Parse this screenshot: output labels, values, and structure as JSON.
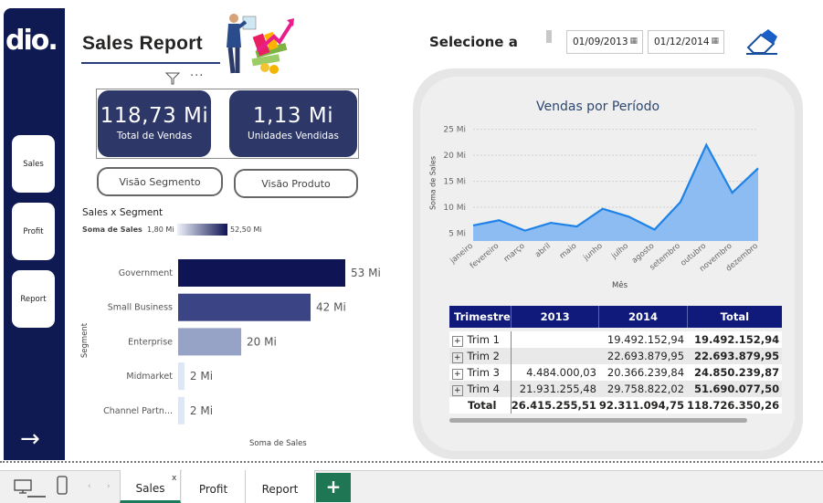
{
  "sidebar": {
    "logo": "dio.",
    "items": [
      {
        "label": "Sales"
      },
      {
        "label": "Profit"
      },
      {
        "label": "Report"
      }
    ],
    "arrow": "→"
  },
  "header": {
    "title": "Sales Report"
  },
  "kpis": [
    {
      "value": "118,73 Mi",
      "label": "Total de Vendas"
    },
    {
      "value": "1,13 Mi",
      "label": "Unidades Vendidas"
    }
  ],
  "buttons": {
    "segment": "Visão Segmento",
    "product": "Visão Produto"
  },
  "filter": {
    "label": "Selecione a",
    "start": "01/09/2013",
    "end": "01/12/2014"
  },
  "bar_chart": {
    "title": "Sales x Segment",
    "legend_label": "Soma de  Sales",
    "legend_min": "1,80 Mi",
    "legend_max": "52,50 Mi",
    "ylabel": "Segment",
    "xlabel": "Soma de Sales"
  },
  "line_chart": {
    "title": "Vendas por Período",
    "ylabel": "Soma de Sales",
    "xlabel": "Mês"
  },
  "chart_data": [
    {
      "type": "bar",
      "title": "Sales x Segment",
      "categories": [
        "Government",
        "Small Business",
        "Enterprise",
        "Midmarket",
        "Channel Partn..."
      ],
      "values": [
        53,
        42,
        20,
        2,
        2
      ],
      "value_labels": [
        "53 Mi",
        "42 Mi",
        "20 Mi",
        "2 Mi",
        "2 Mi"
      ],
      "colors": [
        "#0f1454",
        "#3b4485",
        "#96a2c6",
        "#dde6f6",
        "#dde6f6"
      ],
      "xlabel": "Soma de Sales",
      "ylabel": "Segment"
    },
    {
      "type": "area",
      "title": "Vendas por Período",
      "x": [
        "janeiro",
        "fevereiro",
        "março",
        "abril",
        "maio",
        "junho",
        "julho",
        "agosto",
        "setembro",
        "outubro",
        "novembro",
        "dezembro"
      ],
      "values": [
        6.5,
        7.5,
        5.5,
        7,
        6.3,
        9.7,
        8.2,
        5.7,
        11,
        22,
        12.8,
        17.5
      ],
      "yticks": [
        "25 Mi",
        "20 Mi",
        "15 Mi",
        "10 Mi",
        "5 Mi"
      ],
      "ytick_values": [
        25,
        20,
        15,
        10,
        5
      ],
      "ylim": [
        3.5,
        26
      ],
      "xlabel": "Mês",
      "ylabel": "Soma de Sales",
      "grid": true
    }
  ],
  "table": {
    "headers": [
      "Trimestre",
      "2013",
      "2014",
      "Total"
    ],
    "rows": [
      {
        "label": "Trim 1",
        "c2013": "",
        "c2014": "19.492.152,94",
        "total": "19.492.152,94"
      },
      {
        "label": "Trim 2",
        "c2013": "",
        "c2014": "22.693.879,95",
        "total": "22.693.879,95"
      },
      {
        "label": "Trim 3",
        "c2013": "4.484.000,03",
        "c2014": "20.366.239,84",
        "total": "24.850.239,87"
      },
      {
        "label": "Trim 4",
        "c2013": "21.931.255,48",
        "c2014": "29.758.822,02",
        "total": "51.690.077,50"
      }
    ],
    "total": {
      "label": "Total",
      "c2013": "26.415.255,51",
      "c2014": "92.311.094,75",
      "total": "118.726.350,26"
    }
  },
  "bottom_tabs": [
    {
      "label": "Sales",
      "close": "x"
    },
    {
      "label": "Profit"
    },
    {
      "label": "Report"
    }
  ],
  "add_tab": "+"
}
